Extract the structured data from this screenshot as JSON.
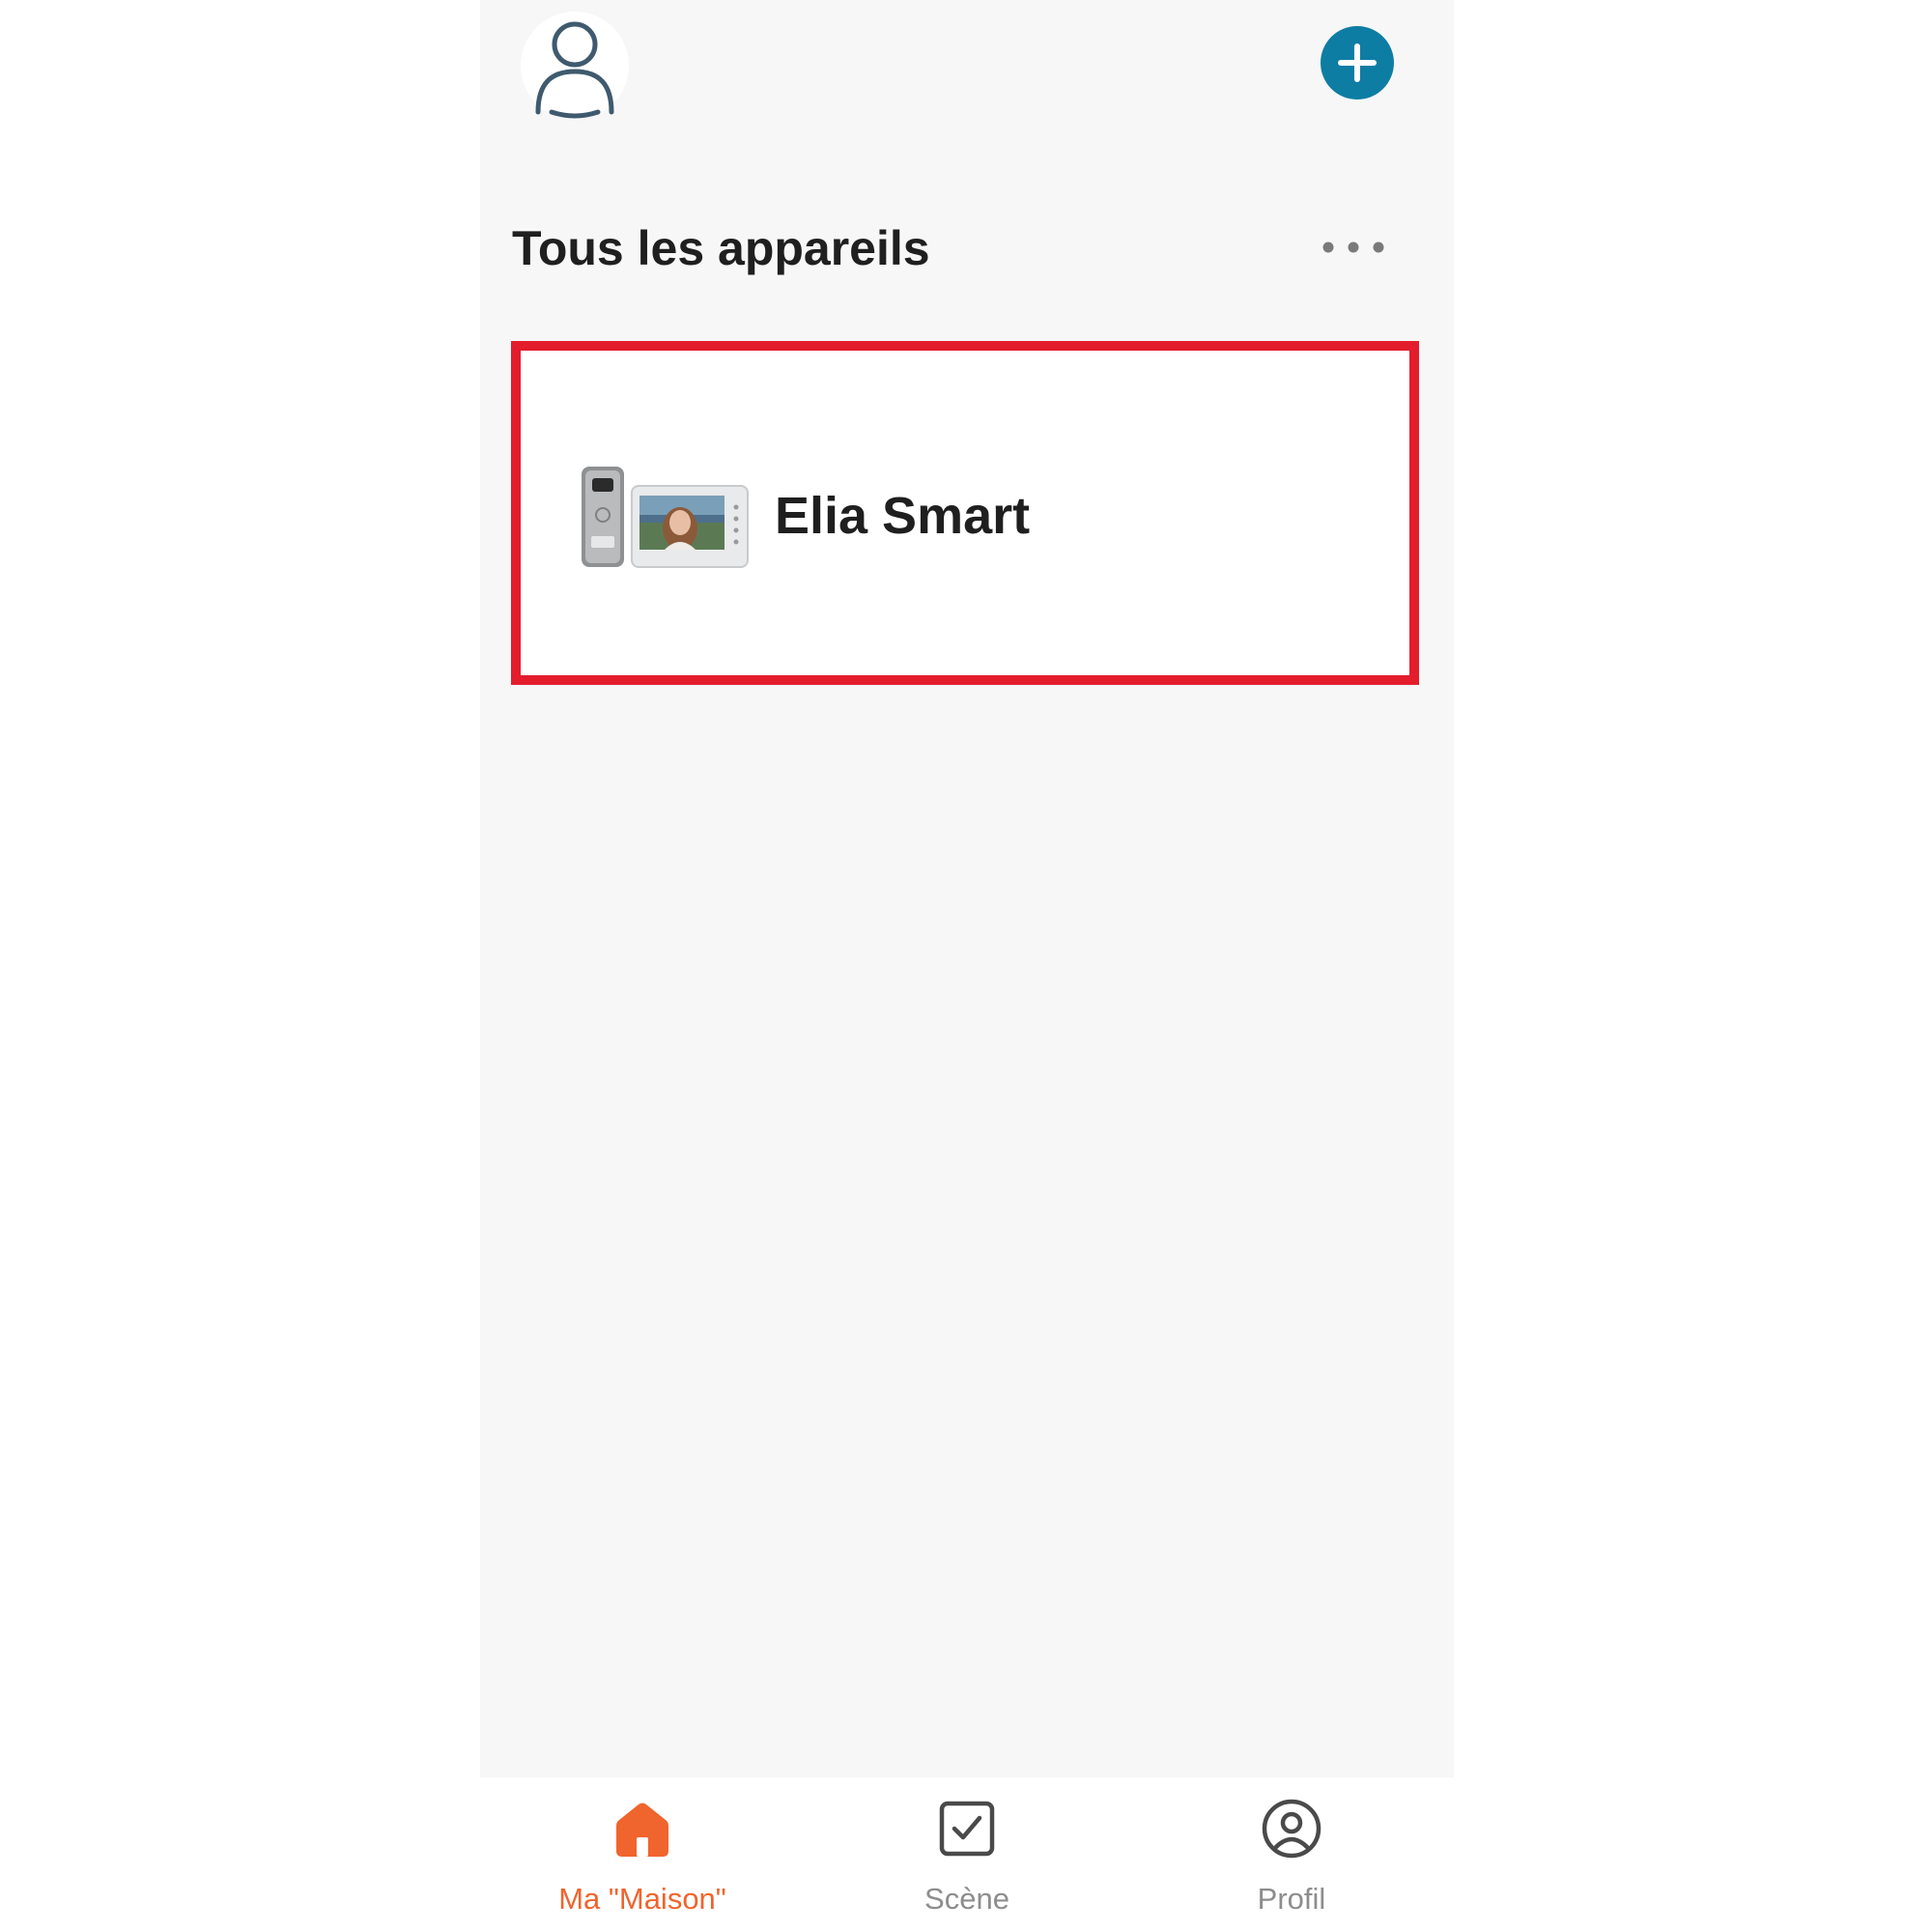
{
  "header": {
    "avatar_icon": "user-outline-icon",
    "add_icon": "plus-circle-icon",
    "accent_color": "#0e7da3"
  },
  "section": {
    "title": "Tous les appareils",
    "more_icon": "ellipsis-icon"
  },
  "devices": [
    {
      "name": "Elia Smart",
      "thumbnail": "video-intercom-kit-image",
      "highlight_color": "#e41d2d"
    }
  ],
  "tabbar": {
    "active_color": "#f0642d",
    "inactive_color": "#8d8d8d",
    "tabs": [
      {
        "label": "Ma \"Maison\"",
        "icon": "home-icon",
        "active": true
      },
      {
        "label": "Scène",
        "icon": "checkbox-icon",
        "active": false
      },
      {
        "label": "Profil",
        "icon": "user-circle-icon",
        "active": false
      }
    ]
  }
}
